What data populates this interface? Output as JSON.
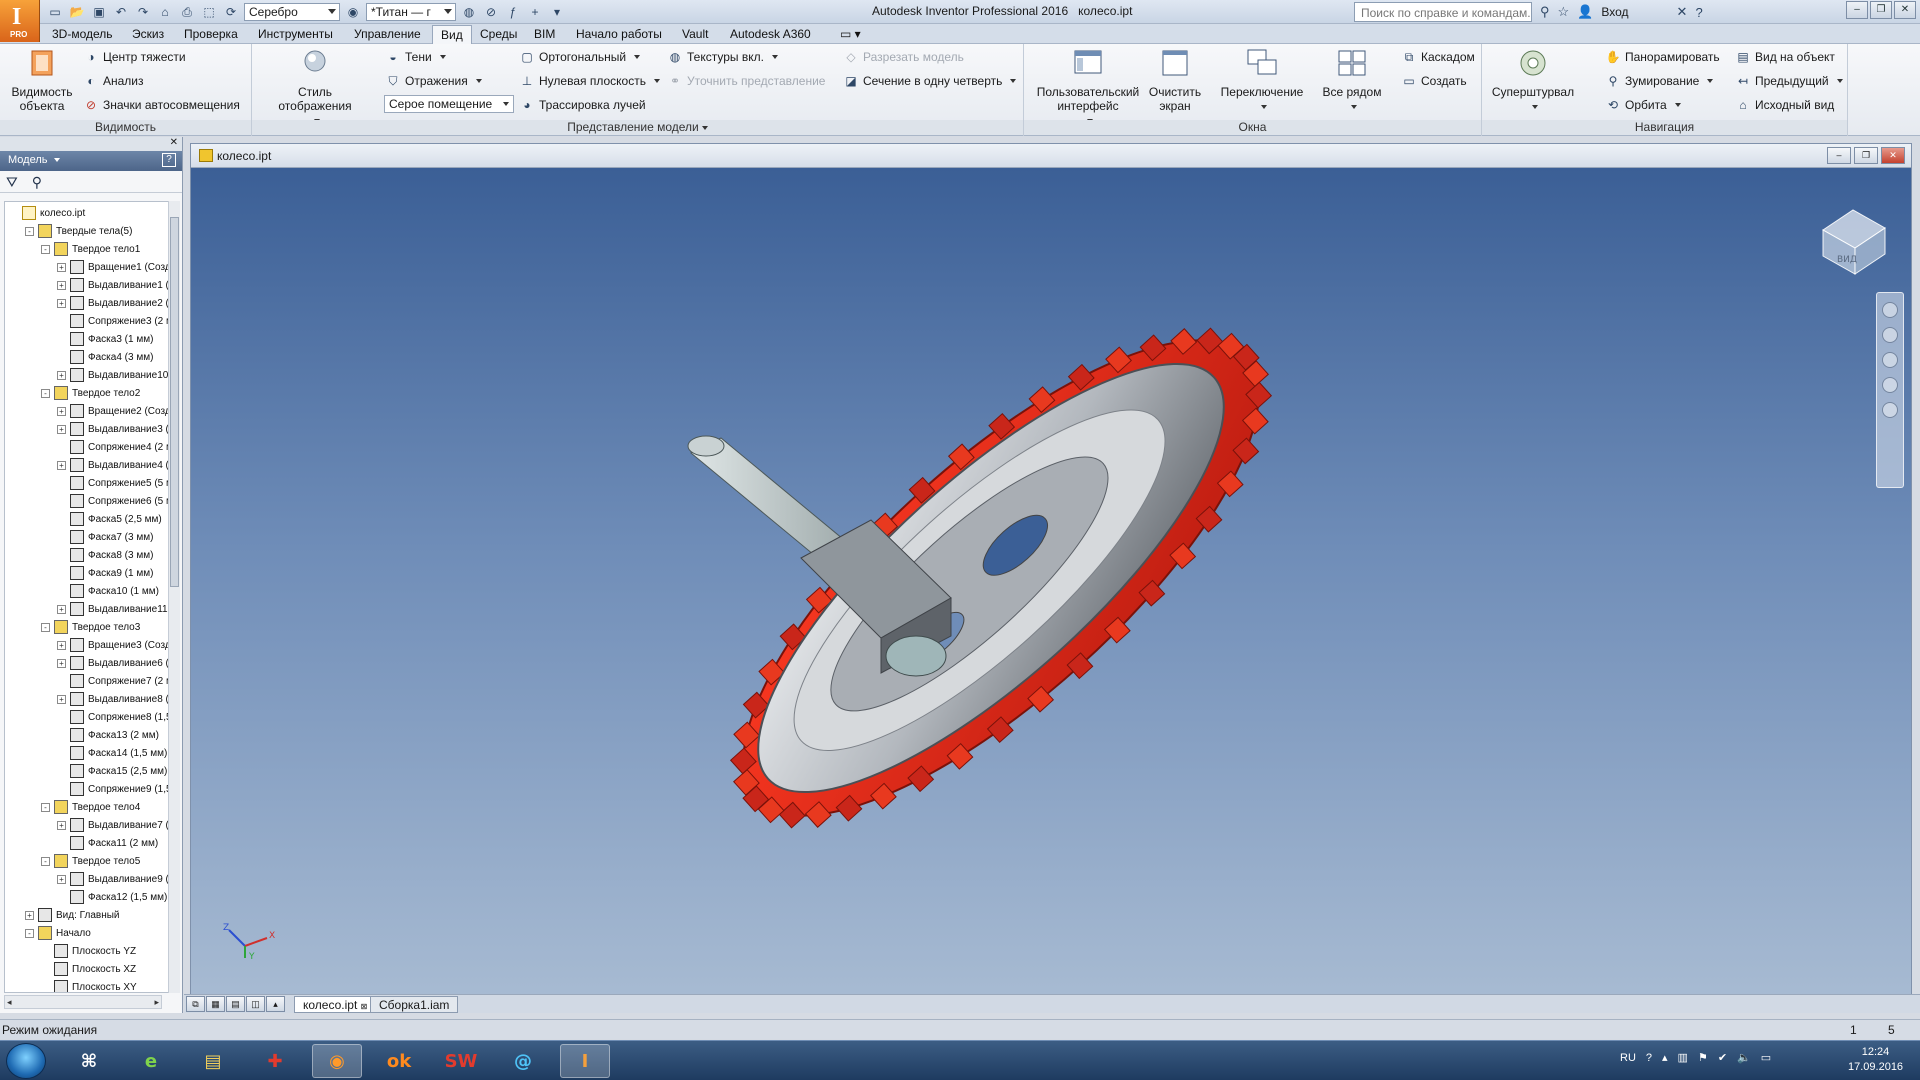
{
  "app": {
    "title": "Autodesk Inventor Professional 2016",
    "document_name": "колесо.ipt",
    "logo_letter": "I",
    "logo_badge": "PRO"
  },
  "quick_access": {
    "material_combo": "Серебро",
    "appearance_combo": "*Титан — г"
  },
  "help_search": {
    "placeholder": "Поиск по справке и командам..."
  },
  "signin": {
    "label": "Вход"
  },
  "tabs": [
    {
      "label": "3D-модель"
    },
    {
      "label": "Эскиз"
    },
    {
      "label": "Проверка"
    },
    {
      "label": "Инструменты"
    },
    {
      "label": "Управление"
    },
    {
      "label": "Вид",
      "active": true
    },
    {
      "label": "Среды"
    },
    {
      "label": "BIM"
    },
    {
      "label": "Начало работы"
    },
    {
      "label": "Vault"
    },
    {
      "label": "Autodesk A360"
    }
  ],
  "ribbon": {
    "visibility": {
      "title": "Видимость",
      "big_button": "Видимость объекта",
      "items": [
        "Центр тяжести",
        "Анализ",
        "Значки автосовмещения"
      ]
    },
    "appearance": {
      "title": "Представление модели",
      "big_button": "Стиль отображения",
      "shadows": "Тени",
      "reflections": "Отражения",
      "background_combo": "Серое помещение",
      "ortho": "Ортогональный",
      "ground_plane": "Нулевая плоскость",
      "ray_tracing": "Трассировка лучей",
      "textures": "Текстуры вкл.",
      "refine": "Уточнить представление",
      "slice": "Разрезать модель",
      "quarter_section": "Сечение в одну четверть"
    },
    "windows": {
      "title": "Окна",
      "user_interface": "Пользовательский интерфейс",
      "clean_screen": "Очистить экран",
      "switch": "Переключение",
      "tile": "Все рядом",
      "cascade": "Каскадом",
      "new": "Создать"
    },
    "navigation": {
      "title": "Навигация",
      "steering_wheels": "Суперштурвал",
      "pan": "Панорамировать",
      "zoom": "Зумирование",
      "orbit": "Орбита",
      "look_at": "Вид на объект",
      "previous": "Предыдущий",
      "home": "Исходный вид"
    }
  },
  "browser": {
    "title": "Модель",
    "tree": [
      {
        "label": "колесо.ipt",
        "level": 0,
        "kind": "part"
      },
      {
        "label": "Твердые тела(5)",
        "level": 1,
        "kind": "folder",
        "exp": "-"
      },
      {
        "label": "Твердое тело1",
        "level": 2,
        "kind": "body",
        "exp": "-"
      },
      {
        "label": "Вращение1 (Созд",
        "level": 3,
        "kind": "feat",
        "exp": "+"
      },
      {
        "label": "Выдавливание1 (",
        "level": 3,
        "kind": "feat",
        "exp": "+"
      },
      {
        "label": "Выдавливание2 (",
        "level": 3,
        "kind": "feat",
        "exp": "+"
      },
      {
        "label": "Сопряжение3 (2 м",
        "level": 3,
        "kind": "feat"
      },
      {
        "label": "Фаска3 (1 мм)",
        "level": 3,
        "kind": "feat"
      },
      {
        "label": "Фаска4 (3 мм)",
        "level": 3,
        "kind": "feat"
      },
      {
        "label": "Выдавливание10",
        "level": 3,
        "kind": "feat",
        "exp": "+"
      },
      {
        "label": "Твердое тело2",
        "level": 2,
        "kind": "body",
        "exp": "-"
      },
      {
        "label": "Вращение2 (Созд",
        "level": 3,
        "kind": "feat",
        "exp": "+"
      },
      {
        "label": "Выдавливание3 (",
        "level": 3,
        "kind": "feat",
        "exp": "+"
      },
      {
        "label": "Сопряжение4 (2 м",
        "level": 3,
        "kind": "feat"
      },
      {
        "label": "Выдавливание4 (",
        "level": 3,
        "kind": "feat",
        "exp": "+"
      },
      {
        "label": "Сопряжение5 (5 м",
        "level": 3,
        "kind": "feat"
      },
      {
        "label": "Сопряжение6 (5 м",
        "level": 3,
        "kind": "feat"
      },
      {
        "label": "Фаска5 (2,5 мм)",
        "level": 3,
        "kind": "feat"
      },
      {
        "label": "Фаска7 (3 мм)",
        "level": 3,
        "kind": "feat"
      },
      {
        "label": "Фаска8 (3 мм)",
        "level": 3,
        "kind": "feat"
      },
      {
        "label": "Фаска9 (1 мм)",
        "level": 3,
        "kind": "feat"
      },
      {
        "label": "Фаска10 (1 мм)",
        "level": 3,
        "kind": "feat"
      },
      {
        "label": "Выдавливание11 (",
        "level": 3,
        "kind": "feat",
        "exp": "+"
      },
      {
        "label": "Твердое тело3",
        "level": 2,
        "kind": "body",
        "exp": "-"
      },
      {
        "label": "Вращение3 (Созд",
        "level": 3,
        "kind": "feat",
        "exp": "+"
      },
      {
        "label": "Выдавливание6 (",
        "level": 3,
        "kind": "feat",
        "exp": "+"
      },
      {
        "label": "Сопряжение7 (2 м",
        "level": 3,
        "kind": "feat"
      },
      {
        "label": "Выдавливание8 (",
        "level": 3,
        "kind": "feat",
        "exp": "+"
      },
      {
        "label": "Сопряжение8 (1,5",
        "level": 3,
        "kind": "feat"
      },
      {
        "label": "Фаска13 (2 мм)",
        "level": 3,
        "kind": "feat"
      },
      {
        "label": "Фаска14 (1,5 мм)",
        "level": 3,
        "kind": "feat"
      },
      {
        "label": "Фаска15 (2,5 мм)",
        "level": 3,
        "kind": "feat"
      },
      {
        "label": "Сопряжение9 (1,5",
        "level": 3,
        "kind": "feat"
      },
      {
        "label": "Твердое тело4",
        "level": 2,
        "kind": "body",
        "exp": "-"
      },
      {
        "label": "Выдавливание7 (",
        "level": 3,
        "kind": "feat",
        "exp": "+"
      },
      {
        "label": "Фаска11 (2 мм)",
        "level": 3,
        "kind": "feat"
      },
      {
        "label": "Твердое тело5",
        "level": 2,
        "kind": "body",
        "exp": "-"
      },
      {
        "label": "Выдавливание9 (",
        "level": 3,
        "kind": "feat",
        "exp": "+"
      },
      {
        "label": "Фаска12 (1,5 мм)",
        "level": 3,
        "kind": "feat"
      },
      {
        "label": "Вид: Главный",
        "level": 1,
        "kind": "feat",
        "exp": "+"
      },
      {
        "label": "Начало",
        "level": 1,
        "kind": "folder",
        "exp": "-"
      },
      {
        "label": "Плоскость YZ",
        "level": 2,
        "kind": "feat"
      },
      {
        "label": "Плоскость XZ",
        "level": 2,
        "kind": "feat"
      },
      {
        "label": "Плоскость XY",
        "level": 2,
        "kind": "feat"
      }
    ]
  },
  "viewport": {
    "viewcube_face": "ВИД",
    "triad": {
      "x": "X",
      "y": "Y",
      "z": "Z"
    },
    "colors": {
      "tread": "#d8301e",
      "hub": "#c9cdd2",
      "background_top": "#3b5f96",
      "background_bottom": "#a9bcd3"
    }
  },
  "doc_tabs": [
    {
      "label": "колесо.ipt",
      "active": true
    },
    {
      "label": "Сборка1.iam",
      "active": false
    }
  ],
  "status": {
    "message": "Режим ожидания",
    "count_a": "1",
    "count_b": "5"
  },
  "taskbar": {
    "apps": [
      "xp-icon",
      "ie-icon",
      "explorer-icon",
      "red-cross-icon",
      "firefox-icon",
      "odnoklassniki-icon",
      "solidworks-icon",
      "mail-icon",
      "inventor-icon"
    ],
    "language": "RU",
    "time": "12:24",
    "date": "17.09.2016"
  }
}
